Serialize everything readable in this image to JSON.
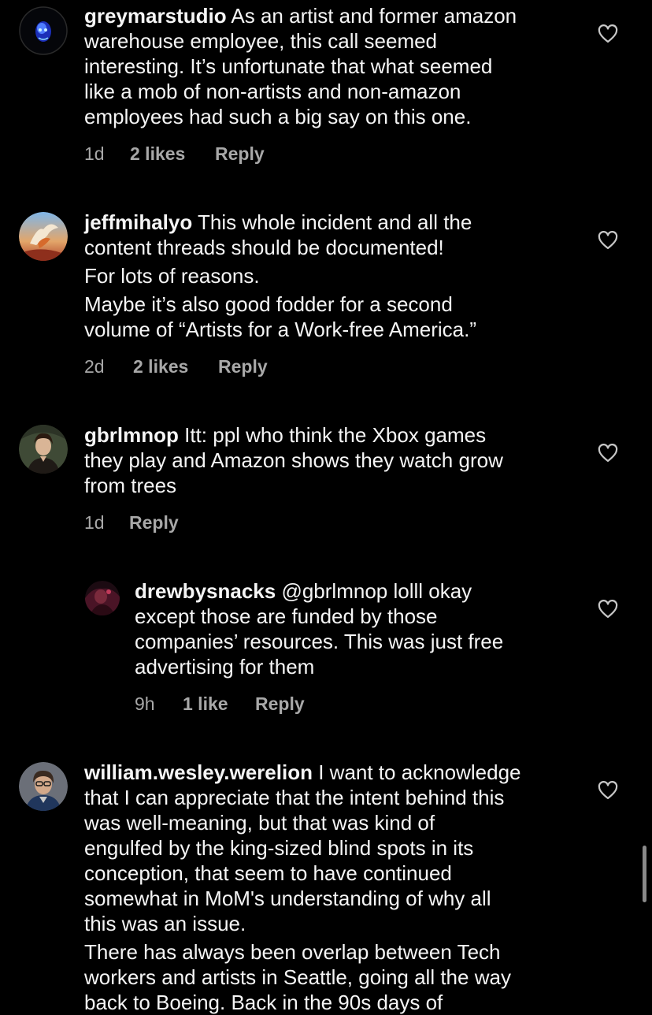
{
  "comments": [
    {
      "username": "greymarstudio",
      "lines": [
        "As an artist and former amazon",
        "warehouse employee, this call seemed",
        "interesting. It’s unfortunate that what seemed",
        "like a mob of non-artists and non-amazon",
        "employees had such a big say on this one."
      ],
      "time": "1d",
      "likes": "2 likes",
      "reply": "Reply"
    },
    {
      "username": "jeffmihalyo",
      "lines": [
        "This whole incident and all the",
        "content threads should be documented!"
      ],
      "paragraphs": [
        [
          "For lots of reasons."
        ],
        [
          "Maybe it’s also good fodder for a second",
          "volume of “Artists for a Work-free America.”"
        ]
      ],
      "time": "2d",
      "likes": "2 likes",
      "reply": "Reply"
    },
    {
      "username": "gbrlmnop",
      "lines": [
        "Itt: ppl who think the Xbox games",
        "they play and Amazon shows they watch grow",
        "from trees"
      ],
      "time": "1d",
      "reply": "Reply"
    },
    {
      "username": "drewbysnacks",
      "lines": [
        "@gbrlmnop lolll okay",
        "except those are funded by those",
        "companies’ resources. This was just free",
        "advertising for them"
      ],
      "time": "9h",
      "likes": "1 like",
      "reply": "Reply"
    },
    {
      "username": "william.wesley.werelion",
      "lines": [
        "I want to acknowledge",
        "that I can appreciate that the intent behind this",
        "was well-meaning, but that was kind of",
        "engulfed by the king-sized blind spots in its",
        "conception, that seem to have continued",
        "somewhat in MoM's understanding of why all",
        "this was an issue."
      ],
      "paragraphs": [
        [
          "There has always been overlap between Tech",
          "workers and artists in Seattle, going all the way",
          "back to Boeing. Back in the 90s days of"
        ]
      ]
    }
  ],
  "colors": {
    "background": "#000000",
    "text": "#f5f5f5",
    "meta": "#a8a8a8"
  },
  "icons": {
    "like": "heart-outline-icon"
  }
}
